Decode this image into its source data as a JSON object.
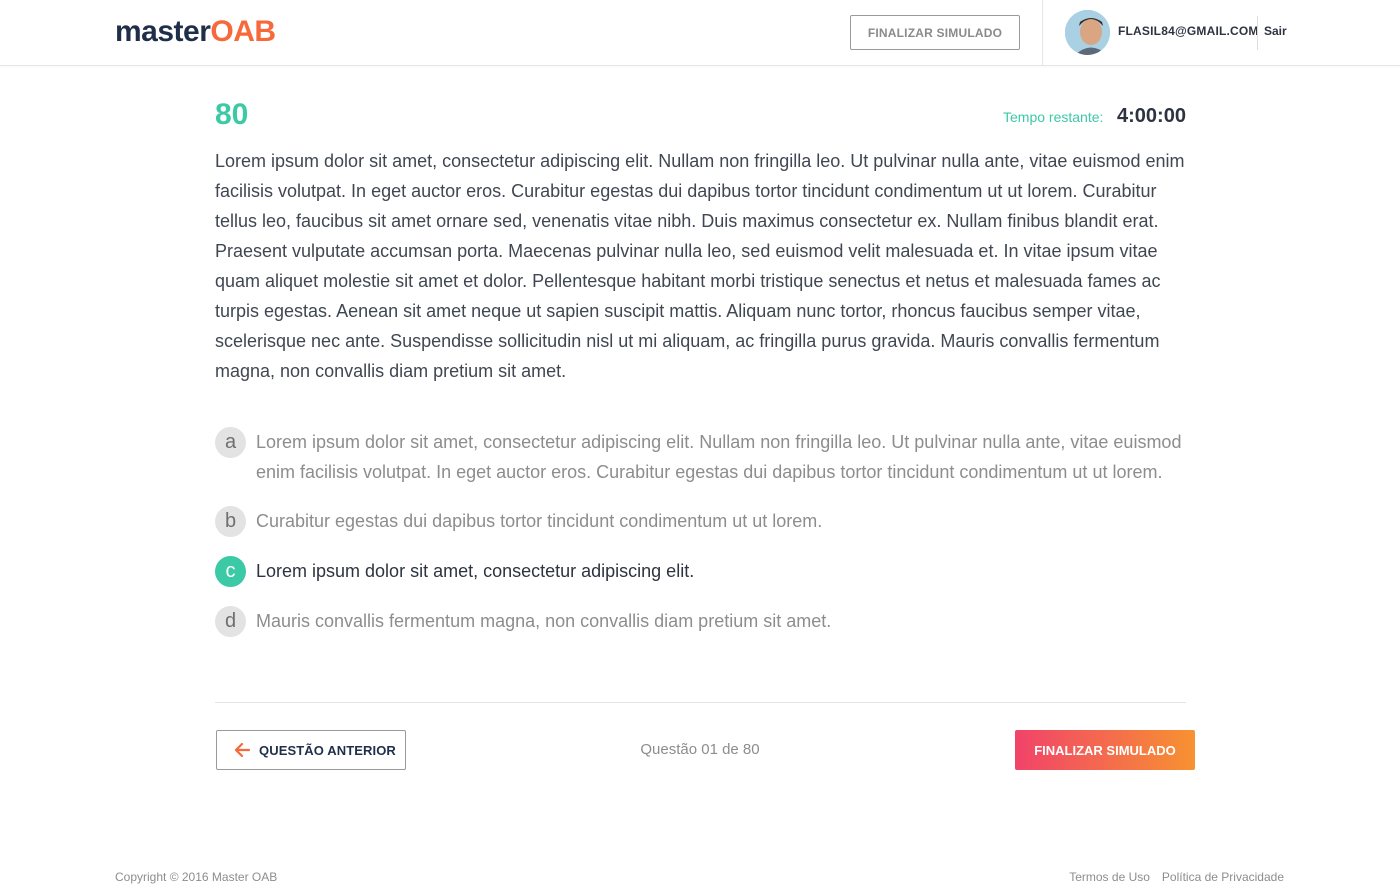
{
  "header": {
    "logo_part1": "master",
    "logo_part2": "OAB",
    "finish_button": "FINALIZAR SIMULADO",
    "user_email": "FLASIL84@GMAIL.COM",
    "logout": "Sair"
  },
  "question": {
    "number": "80",
    "timer_label": "Tempo restante:",
    "timer_value": "4:00:00",
    "text": "Lorem ipsum dolor sit amet, consectetur adipiscing elit. Nullam non fringilla leo. Ut pulvinar nulla ante, vitae euismod enim facilisis volutpat. In eget auctor eros. Curabitur egestas dui dapibus tortor tincidunt condimentum ut ut lorem. Curabitur tellus leo, faucibus sit amet ornare sed, venenatis vitae nibh. Duis maximus consectetur ex. Nullam finibus blandit erat. Praesent vulputate accumsan porta. Maecenas pulvinar nulla leo, sed euismod velit malesuada et. In vitae ipsum vitae quam aliquet molestie sit amet et dolor. Pellentesque habitant morbi tristique senectus et netus et malesuada fames ac turpis egestas. Aenean sit amet neque ut sapien suscipit mattis. Aliquam nunc tortor, rhoncus faucibus semper vitae, scelerisque nec ante. Suspendisse sollicitudin nisl ut mi aliquam, ac fringilla purus gravida. Mauris convallis fermentum magna, non convallis diam pretium sit amet.",
    "options": [
      {
        "letter": "a",
        "text": "Lorem ipsum dolor sit amet, consectetur adipiscing elit. Nullam non fringilla leo. Ut pulvinar nulla ante, vitae euismod enim facilisis volutpat. In eget auctor eros. Curabitur egestas dui dapibus tortor tincidunt condimentum ut ut lorem."
      },
      {
        "letter": "b",
        "text": "Curabitur egestas dui dapibus tortor tincidunt condimentum ut ut lorem."
      },
      {
        "letter": "c",
        "text": "Lorem ipsum dolor sit amet, consectetur adipiscing elit."
      },
      {
        "letter": "d",
        "text": "Mauris convallis fermentum magna, non convallis diam pretium sit amet."
      }
    ],
    "selected": "c"
  },
  "nav": {
    "prev_button": "QUESTÃO ANTERIOR",
    "pager": "Questão 01 de 80",
    "finish_button": "FINALIZAR SIMULADO"
  },
  "footer": {
    "copyright": "Copyright © 2016 Master OAB",
    "terms": "Termos de Uso",
    "privacy": "Política de Privacidade"
  },
  "colors": {
    "accent_green": "#3cc9a6",
    "logo_orange": "#f7683a",
    "navy": "#1f2f4a",
    "gradient_start": "#f1436a",
    "gradient_end": "#f79231"
  }
}
